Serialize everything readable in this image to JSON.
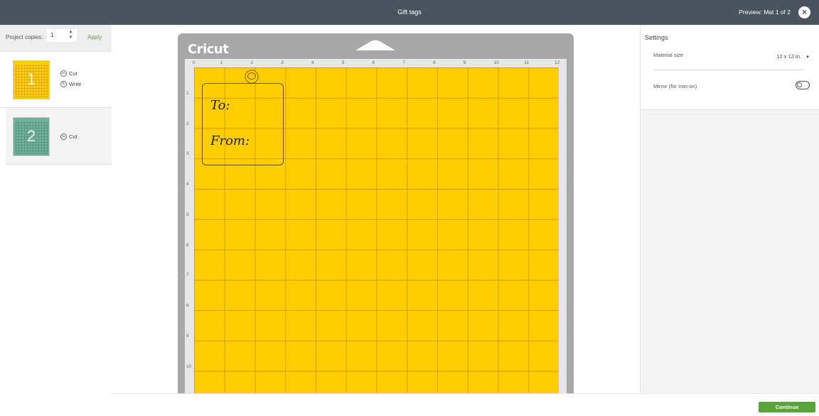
{
  "header": {
    "title": "Gift tags",
    "preview_text": "Preview: Mat 1 of 2",
    "close_symbol": "×"
  },
  "left_panel": {
    "copies_label": "Project copies:",
    "copies_value": "1",
    "apply_label": "Apply",
    "mats": [
      {
        "number": "1",
        "color": "#ffcd00",
        "operations": [
          {
            "icon": "cut-icon",
            "label": "Cut"
          },
          {
            "icon": "write-icon",
            "label": "Write"
          }
        ]
      },
      {
        "number": "2",
        "color": "#6fb29a",
        "operations": [
          {
            "icon": "cut-icon",
            "label": "Cut"
          }
        ]
      }
    ]
  },
  "canvas": {
    "logo": "Cricut",
    "mat_color": "#ffcd00",
    "ruler_top": [
      "0",
      "1",
      "2",
      "3",
      "4",
      "5",
      "6",
      "7",
      "8",
      "9",
      "10",
      "11",
      "12"
    ],
    "ruler_left": [
      "1",
      "2",
      "3",
      "4",
      "5",
      "6",
      "7",
      "8",
      "9",
      "10"
    ],
    "tag_line1": "To:",
    "tag_line2": "From:"
  },
  "settings": {
    "title": "Settings",
    "material_size_label": "Material size",
    "material_size_value": "12 x 12 in.",
    "mirror_label": "Mirror (for Iron-on)",
    "mirror_on": false
  },
  "footer": {
    "continue_label": "Continue"
  },
  "colors": {
    "header_bg": "#4a545e",
    "accent_green": "#5aa23a",
    "mat_yellow": "#ffcd00"
  }
}
